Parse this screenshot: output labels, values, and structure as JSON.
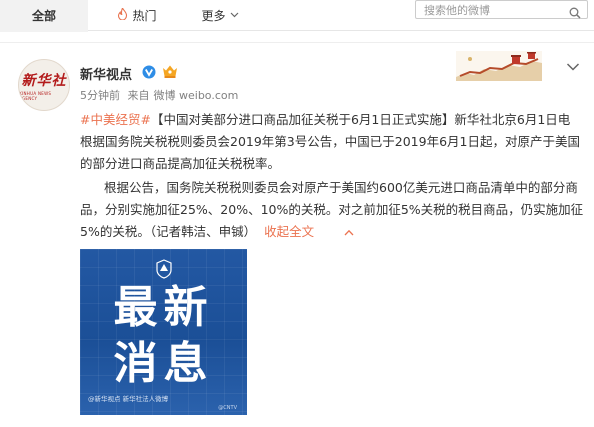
{
  "tabs": {
    "all": "全部",
    "hot": "热门",
    "more": "更多"
  },
  "search": {
    "placeholder": "搜索他的微博"
  },
  "post": {
    "author": "新华视点",
    "avatar_logo": "新华社",
    "avatar_sub": "XINHUA NEWS AGENCY",
    "time": "5分钟前",
    "source_prefix": "来自",
    "source": "微博 weibo.com",
    "hashtag": "#中美经贸#",
    "para1": "【中国对美部分进口商品加征关税于6月1日正式实施】新华社北京6月1日电 根据国务院关税税则委员会2019年第3号公告，中国已于2019年6月1日起，对原产于美国的部分进口商品提高加征关税税率。",
    "para2": "根据公告，国务院关税税则委员会对原产于美国约600亿美元进口商品清单中的部分商品，分别实施加征25%、20%、10%的关税。对之前加征5%关税的税目商品，仍实施加征5%的关税。（记者韩洁、申铖）",
    "collapse_label": "收起全文",
    "media": {
      "line1": "最新",
      "line2": "消息",
      "footer": "@新华视点  新华社法人微博",
      "footer2": "@CNTV"
    }
  },
  "colors": {
    "accent": "#eb7350",
    "link": "#eb7350",
    "media_bg": "#1f549c"
  },
  "icons": {
    "hot": "flame-icon",
    "more": "chevron-down-icon",
    "search": "search-icon",
    "verified": "verified-v-icon",
    "level": "member-badge-icon",
    "post_menu": "chevron-down-icon",
    "collapse": "chevron-up-icon"
  }
}
